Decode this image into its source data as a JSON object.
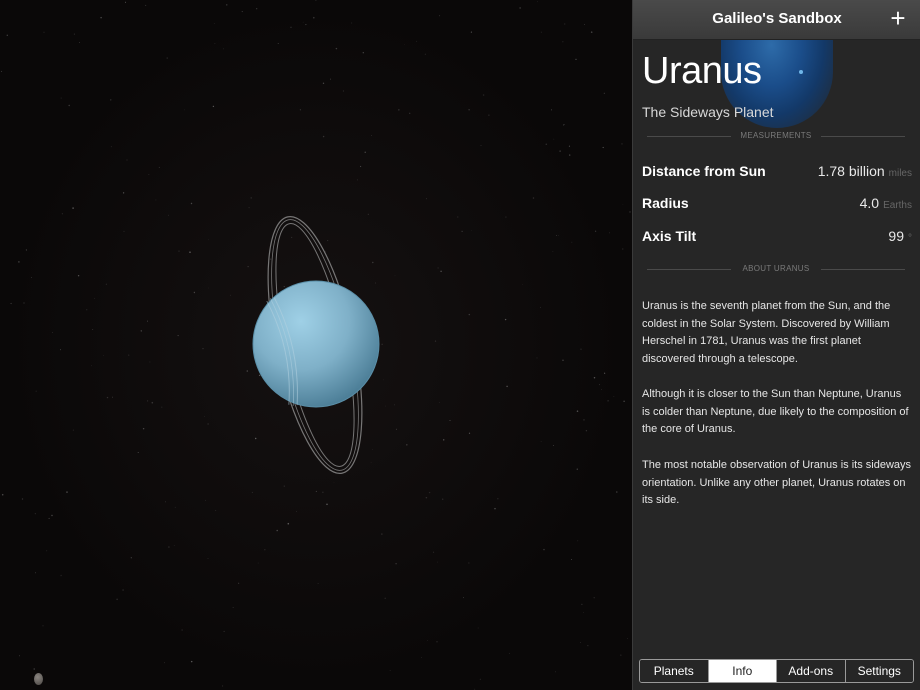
{
  "navbar": {
    "title": "Galileo's Sandbox",
    "add_icon": "plus-icon",
    "add_label": "+"
  },
  "planet": {
    "name": "Uranus",
    "subtitle": "The Sideways Planet",
    "color": "#7fb0c8"
  },
  "measurements": {
    "header": "MEASUREMENTS",
    "rows": [
      {
        "label": "Distance from Sun",
        "value": "1.78 billion",
        "unit": "miles"
      },
      {
        "label": "Radius",
        "value": "4.0",
        "unit": "Earths"
      },
      {
        "label": "Axis Tilt",
        "value": "99",
        "unit": "°"
      }
    ]
  },
  "about": {
    "header": "ABOUT URANUS",
    "paragraphs": [
      "Uranus is the seventh planet from the Sun, and the coldest in the Solar System. Discovered by William Herschel in 1781, Uranus was the first planet discovered through a telescope.",
      "Although it is closer to the Sun than Neptune, Uranus is colder than Neptune, due likely to the composition of the core of Uranus.",
      "The most notable observation of Uranus is its sideways orientation. Unlike any other planet, Uranus rotates on its side."
    ]
  },
  "tabs": [
    {
      "label": "Planets",
      "active": false
    },
    {
      "label": "Info",
      "active": true
    },
    {
      "label": "Add-ons",
      "active": false
    },
    {
      "label": "Settings",
      "active": false
    }
  ]
}
